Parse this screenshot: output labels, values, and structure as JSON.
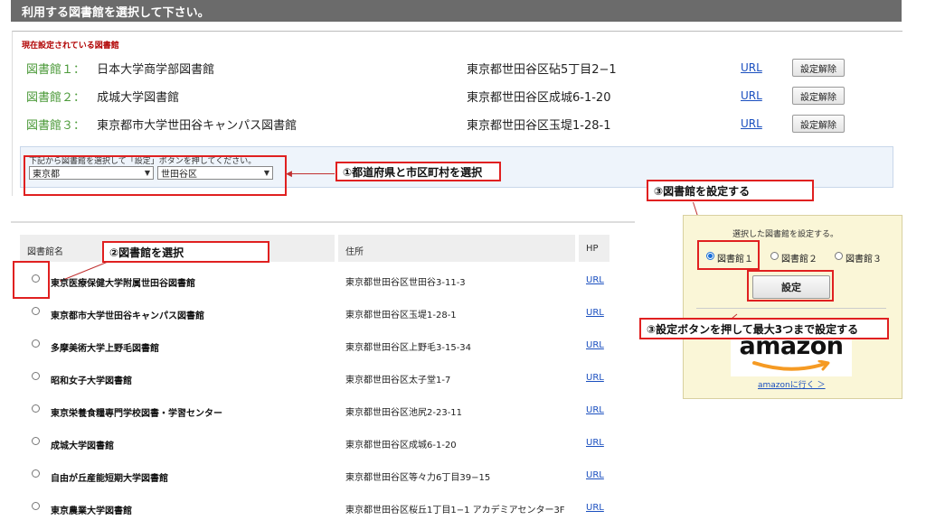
{
  "header": {
    "title": "利用する図書館を選択して下さい。"
  },
  "current": {
    "heading": "現在設定されている図書館",
    "rows": [
      {
        "num": "図書館１：",
        "name": "日本大学商学部図書館",
        "address": "東京都世田谷区砧5丁目2−1",
        "url": "URL",
        "release": "設定解除"
      },
      {
        "num": "図書館２：",
        "name": "成城大学図書館",
        "address": "東京都世田谷区成城6-1-20",
        "url": "URL",
        "release": "設定解除"
      },
      {
        "num": "図書館３：",
        "name": "東京都市大学世田谷キャンパス図書館",
        "address": "東京都世田谷区玉堤1-28-1",
        "url": "URL",
        "release": "設定解除"
      }
    ]
  },
  "select": {
    "instruction": "下記から図書館を選択して「設定」ボタンを押してください。",
    "prefecture": "東京都",
    "city": "世田谷区"
  },
  "callouts": {
    "step1": "①都道府県と市区町村を選択",
    "step2": "②図書館を選択",
    "step3a": "③図書館を設定する",
    "step3b": "③設定ボタンを押して最大3つまで設定する"
  },
  "table": {
    "headers": {
      "name": "図書館名",
      "address": "住所",
      "hp": "HP"
    },
    "rows": [
      {
        "name": "東京医療保健大学附属世田谷図書館",
        "address": "東京都世田谷区世田谷3-11-3",
        "url": "URL"
      },
      {
        "name": "東京都市大学世田谷キャンパス図書館",
        "address": "東京都世田谷区玉堤1-28-1",
        "url": "URL"
      },
      {
        "name": "多摩美術大学上野毛図書館",
        "address": "東京都世田谷区上野毛3-15-34",
        "url": "URL"
      },
      {
        "name": "昭和女子大学図書館",
        "address": "東京都世田谷区太子堂1-7",
        "url": "URL"
      },
      {
        "name": "東京栄養食糧専門学校図書・学習センター",
        "address": "東京都世田谷区池尻2-23-11",
        "url": "URL"
      },
      {
        "name": "成城大学図書館",
        "address": "東京都世田谷区成城6-1-20",
        "url": "URL"
      },
      {
        "name": "自由が丘産能短期大学図書館",
        "address": "東京都世田谷区等々力6丁目39−15",
        "url": "URL"
      },
      {
        "name": "東京農業大学図書館",
        "address": "東京都世田谷区桜丘1丁目1−1 アカデミアセンター3F",
        "url": "URL"
      }
    ]
  },
  "panel": {
    "instruction": "選択した図書館を設定する。",
    "options": [
      "図書館１",
      "図書館２",
      "図書館３"
    ],
    "selected": "図書館１",
    "set_button": "設定",
    "amazon_logo": "amazon",
    "amazon_link": "amazonに行く ＞"
  },
  "colors": {
    "accent_red": "#e02020",
    "link_blue": "#1a4fbf",
    "label_green": "#4c9a3a",
    "panel_yellow": "#faf6d7"
  }
}
